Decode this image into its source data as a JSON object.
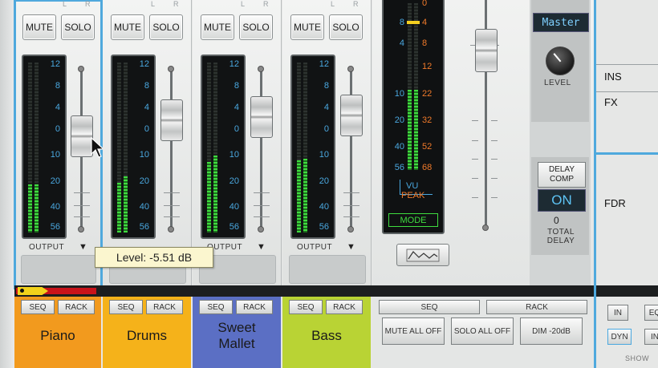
{
  "channel_labels": {
    "l": "L",
    "r": "R"
  },
  "channels": [
    {
      "name": "Piano",
      "mute": "MUTE",
      "solo": "SOLO",
      "output": "OUTPUT",
      "seq": "SEQ",
      "rack": "RACK",
      "color": "#f29a1e"
    },
    {
      "name": "Drums",
      "mute": "MUTE",
      "solo": "SOLO",
      "output": "OUTPUT",
      "seq": "SEQ",
      "rack": "RACK",
      "color": "#f5b21a"
    },
    {
      "name": "Sweet Mallet",
      "mute": "MUTE",
      "solo": "SOLO",
      "output": "OUTPUT",
      "seq": "SEQ",
      "rack": "RACK",
      "color": "#5b6fc4"
    },
    {
      "name": "Bass",
      "mute": "MUTE",
      "solo": "SOLO",
      "output": "OUTPUT",
      "seq": "SEQ",
      "rack": "RACK",
      "color": "#b9d334"
    }
  ],
  "channel_meter_scale": [
    "12",
    "8",
    "4",
    "0",
    "10",
    "20",
    "40",
    "56"
  ],
  "tooltip": {
    "text": "Level: -5.51 dB"
  },
  "master_meter": {
    "left_scale": [
      "8",
      "4",
      "10",
      "20",
      "40",
      "56"
    ],
    "right_scale": [
      "0",
      "4",
      "8",
      "12",
      "22",
      "32",
      "52",
      "68"
    ],
    "vu_label": "VU",
    "peak_label": "PEAK",
    "mode_button": "MODE"
  },
  "master_section": {
    "title": "Master",
    "level_label": "LEVEL",
    "delay_comp_label": "DELAY COMP",
    "delay_on": "ON",
    "delay_value": "0",
    "total_delay_label": "TOTAL DELAY"
  },
  "bottom_master": {
    "seq": "SEQ",
    "rack": "RACK",
    "mute_all_off": "MUTE ALL OFF",
    "solo_all_off": "SOLO ALL OFF",
    "dim": "DIM -20dB"
  },
  "right_panel": {
    "ins": "INS",
    "fx": "FX",
    "fdr": "FDR",
    "in_btn": "IN",
    "eq_btn": "EQ",
    "dyn_btn": "DYN",
    "in2_btn": "IN",
    "show": "SHOW"
  },
  "colors": {
    "accent_blue": "#4aa8e0",
    "meter_green": "#3fdc3f",
    "vu_orange": "#f07a2a",
    "master_display": "#7fd0ff"
  }
}
